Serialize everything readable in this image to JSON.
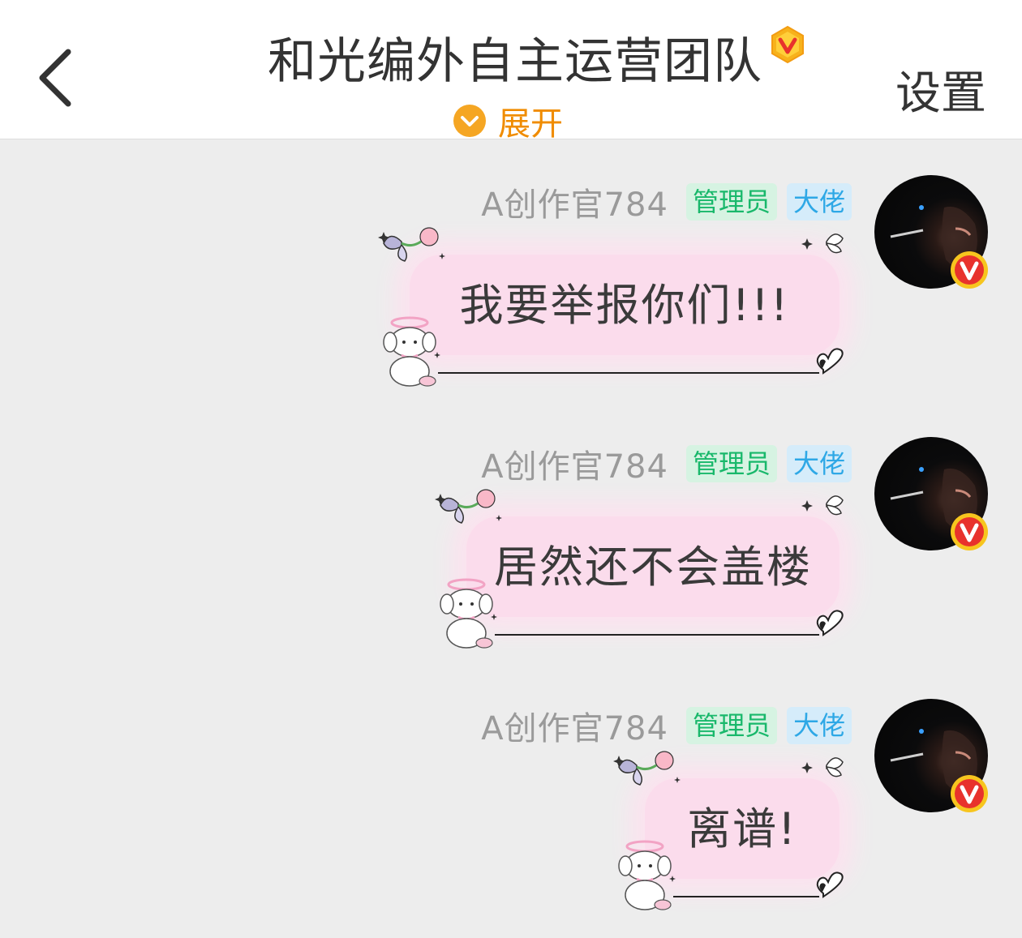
{
  "header": {
    "title": "和光编外自主运营团队",
    "expand_label": "展开",
    "settings_label": "设置"
  },
  "messages": [
    {
      "sender": "A创作官784",
      "tags": {
        "admin": "管理员",
        "boss": "大佬"
      },
      "text": "我要举报你们!!!"
    },
    {
      "sender": "A创作官784",
      "tags": {
        "admin": "管理员",
        "boss": "大佬"
      },
      "text": "居然还不会盖楼"
    },
    {
      "sender": "A创作官784",
      "tags": {
        "admin": "管理员",
        "boss": "大佬"
      },
      "text": "离谱!"
    }
  ],
  "colors": {
    "header_bg": "#ffffff",
    "page_bg": "#ededed",
    "accent_orange": "#f08c00",
    "admin_tag": "#19b86b",
    "boss_tag": "#2ea8e6",
    "bubble_pink": "#fbdcec",
    "verified_red": "#e8322c"
  },
  "icons": [
    "back-chevron-icon",
    "vip-badge-icon",
    "chevron-down-icon",
    "verified-v-icon",
    "butterfly-icon",
    "peach-icon",
    "heart-icon",
    "puppy-sticker-icon",
    "sparkle-icon"
  ]
}
